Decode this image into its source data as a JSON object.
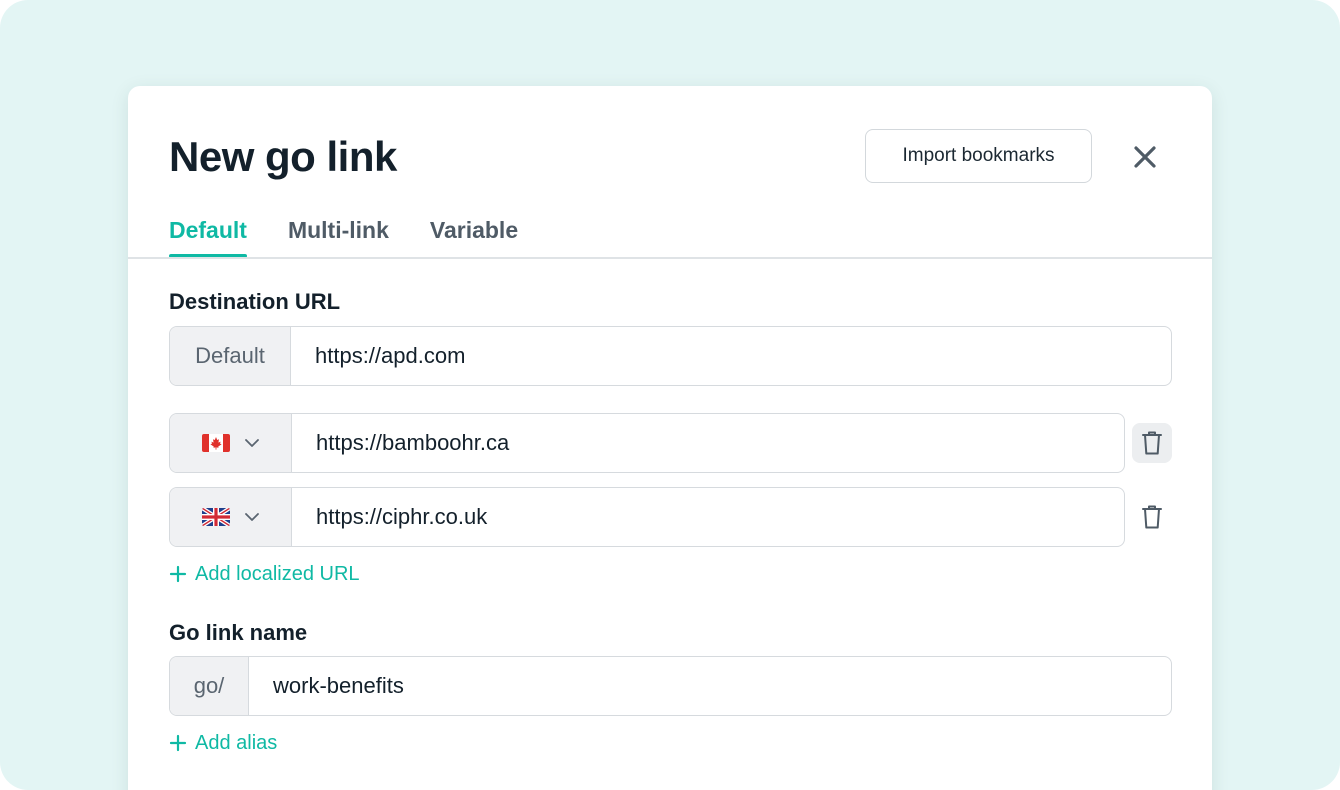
{
  "dialog": {
    "title": "New go link",
    "import_label": "Import bookmarks",
    "close_icon": "close-icon"
  },
  "tabs": [
    {
      "label": "Default",
      "active": true
    },
    {
      "label": "Multi-link",
      "active": false
    },
    {
      "label": "Variable",
      "active": false
    }
  ],
  "destination": {
    "label": "Destination URL",
    "default_addon": "Default",
    "default_url": "https://apd.com",
    "localized": [
      {
        "flag": "canada-flag-icon",
        "url": "https://bamboohr.ca"
      },
      {
        "flag": "uk-flag-icon",
        "url": "https://ciphr.co.uk"
      }
    ],
    "add_localized_label": "Add localized URL"
  },
  "golink": {
    "label": "Go link name",
    "prefix": "go/",
    "value": "work-benefits",
    "add_alias_label": "Add alias"
  },
  "colors": {
    "accent": "#0fb9a4",
    "backdrop": "#e3f5f4",
    "text": "#13202b"
  }
}
